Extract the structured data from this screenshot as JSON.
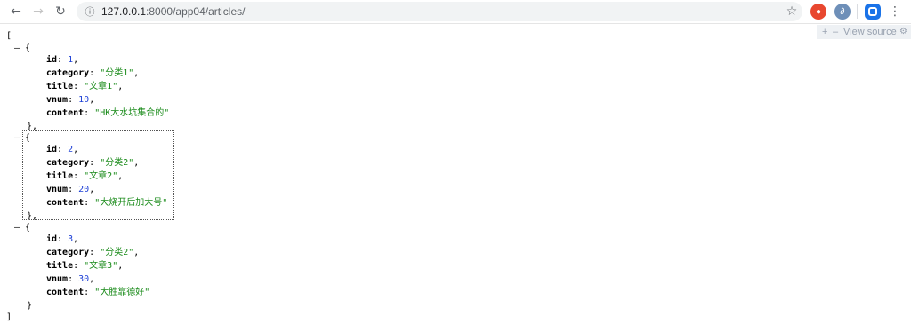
{
  "browser": {
    "back_icon": "arrow-left-icon",
    "forward_icon": "arrow-right-icon",
    "reload_icon": "reload-icon",
    "info_icon": "info-icon",
    "url_host": "127.0.0.1",
    "url_rest": ":8000/app04/articles/",
    "bookmark_icon": "star-icon",
    "menu_icon": "kebab-menu-icon"
  },
  "json_viewer": {
    "expand_label": "+",
    "collapse_label": "–",
    "view_source_label": "View source",
    "settings_icon": "gear-icon"
  },
  "json": {
    "open_bracket": "[",
    "close_bracket": "]",
    "collapser": "–",
    "items": [
      {
        "id": "1",
        "category": "\"分类1\"",
        "title": "\"文章1\"",
        "vnum": "10",
        "content": "\"HK大水坑集合的\""
      },
      {
        "id": "2",
        "category": "\"分类2\"",
        "title": "\"文章2\"",
        "vnum": "20",
        "content": "\"大烧开后加大号\""
      },
      {
        "id": "3",
        "category": "\"分类2\"",
        "title": "\"文章3\"",
        "vnum": "30",
        "content": "\"大胜靠德好\""
      }
    ],
    "keys": {
      "id": "id",
      "category": "category",
      "title": "title",
      "vnum": "vnum",
      "content": "content"
    }
  },
  "colors": {
    "string": "#1a8b1a",
    "number": "#1c3fd6",
    "key": "#000000",
    "toolbar_bg": "#eef1f4",
    "accent": "#1a73e8"
  }
}
